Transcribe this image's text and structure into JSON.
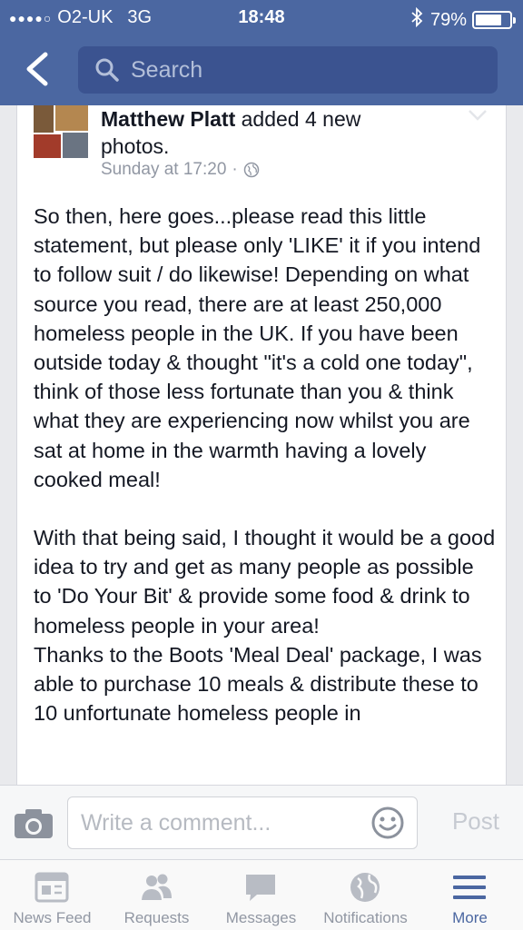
{
  "status_bar": {
    "signal": "●●●●○",
    "carrier": "O2-UK",
    "network": "3G",
    "time": "18:48",
    "battery": "79%",
    "battery_level": 0.79
  },
  "search": {
    "placeholder": "Search"
  },
  "post": {
    "author": "Matthew Platt",
    "action": " added 4 new photos.",
    "timestamp": "Sunday at 17:20",
    "separator": "·",
    "body": [
      "So then, here goes...please read this little statement, but please only 'LIKE' it if you intend to follow suit / do likewise! Depending on what source you read, there are at least 250,000 homeless people in the UK. If you have been outside today & thought \"it's a cold one today\", think of those less fortunate than you & think what they are experiencing now whilst you are sat at home in the warmth having a lovely cooked meal!",
      "With that being said, I thought it would be a good idea to try and get as many people as possible to 'Do Your Bit' & provide some food & drink to homeless people in your area!",
      "Thanks to the Boots 'Meal Deal' package, I was able to purchase 10 meals & distribute these to 10 unfortunate homeless people in"
    ]
  },
  "comment": {
    "placeholder": "Write a comment...",
    "post_label": "Post"
  },
  "tabs": [
    {
      "label": "News Feed",
      "icon": "news-feed-icon"
    },
    {
      "label": "Requests",
      "icon": "friend-requests-icon"
    },
    {
      "label": "Messages",
      "icon": "messages-icon"
    },
    {
      "label": "Notifications",
      "icon": "notifications-globe-icon"
    },
    {
      "label": "More",
      "icon": "more-menu-icon",
      "active": true
    }
  ],
  "colors": {
    "brand": "#4b67a1",
    "text": "#141823",
    "muted": "#9197a3"
  }
}
